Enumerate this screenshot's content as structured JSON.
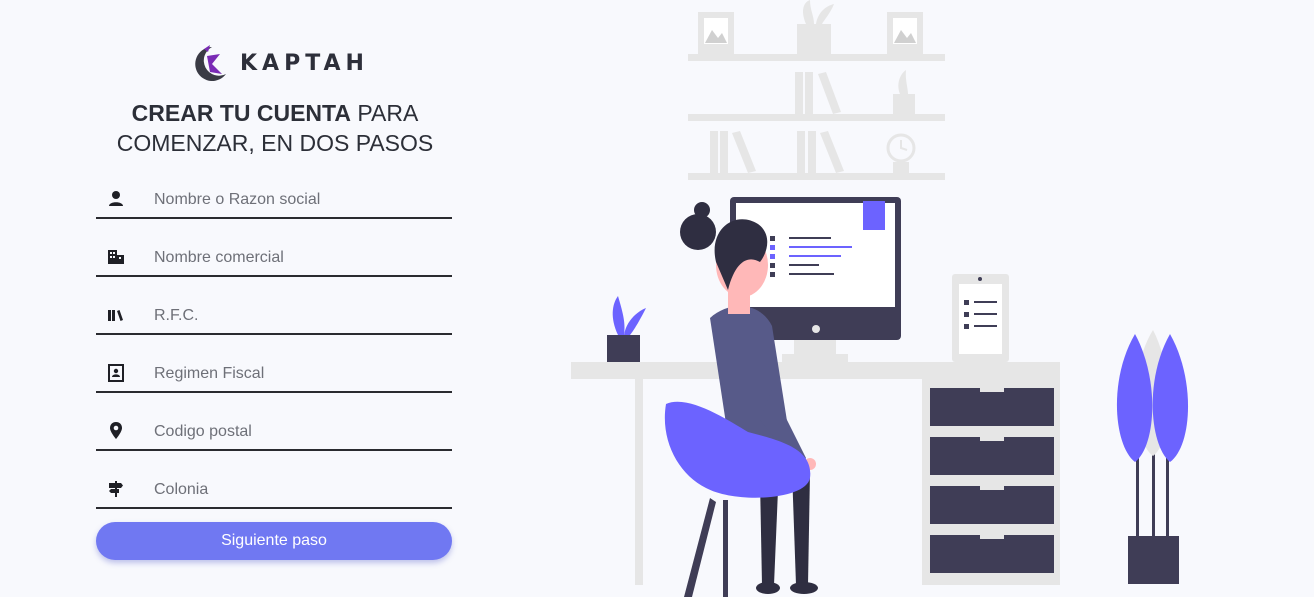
{
  "brand": {
    "name": "KAPTAH"
  },
  "heading": {
    "bold": "CREAR TU CUENTA",
    "normal_1": " PARA",
    "normal_2": "COMENZAR, EN DOS PASOS"
  },
  "form": {
    "fields": [
      {
        "placeholder": "Nombre o Razon social",
        "icon": "person-icon"
      },
      {
        "placeholder": "Nombre comercial",
        "icon": "building-icon"
      },
      {
        "placeholder": "R.F.C.",
        "icon": "books-icon"
      },
      {
        "placeholder": "Regimen Fiscal",
        "icon": "id-card-icon"
      },
      {
        "placeholder": "Codigo postal",
        "icon": "location-pin-icon"
      },
      {
        "placeholder": "Colonia",
        "icon": "signpost-icon"
      }
    ],
    "submit_label": "Siguiente paso"
  },
  "colors": {
    "accent": "#7078f2",
    "illustration_accent": "#6c63ff",
    "dark": "#3f3d56",
    "light_gray": "#e6e6e6"
  }
}
